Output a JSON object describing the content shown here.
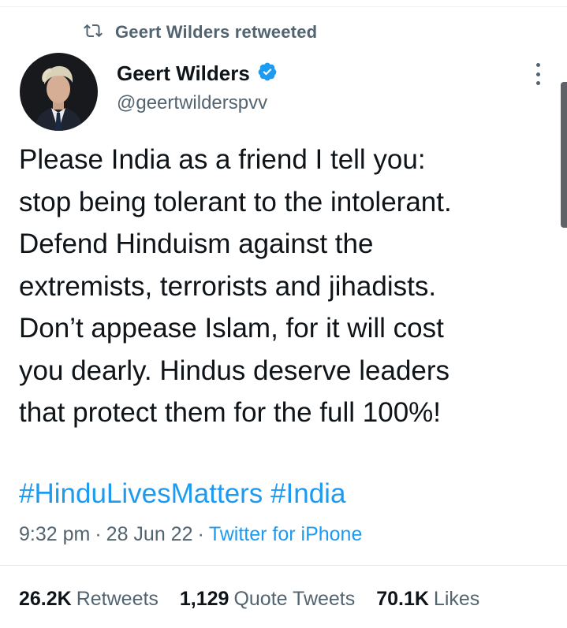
{
  "retweet": {
    "label": "Geert Wilders retweeted",
    "icon": "retweet-icon"
  },
  "author": {
    "name": "Geert Wilders",
    "handle": "@geertwilderspvv",
    "verified": true,
    "verified_color": "#1d9bf0"
  },
  "tweet": {
    "lines": [
      "Please India as a friend I tell you:",
      "stop being tolerant to the intolerant.",
      "Defend Hinduism against the",
      "extremists, terrorists and jihadists.",
      "Don’t appease Islam, for it will cost",
      "you dearly. Hindus deserve leaders",
      "that protect them for the full 100%!"
    ],
    "hashtags": [
      "#HinduLivesMatters",
      "#India"
    ]
  },
  "meta": {
    "time": "9:32 pm",
    "date": "28 Jun 22",
    "separator": "·",
    "source": "Twitter for iPhone"
  },
  "stats": {
    "retweets": {
      "count": "26.2K",
      "label": "Retweets"
    },
    "quotes": {
      "count": "1,129",
      "label": "Quote Tweets"
    },
    "likes": {
      "count": "70.1K",
      "label": "Likes"
    }
  },
  "colors": {
    "link": "#1d9bf0",
    "secondary_text": "#536471",
    "primary_text": "#0f1419"
  }
}
